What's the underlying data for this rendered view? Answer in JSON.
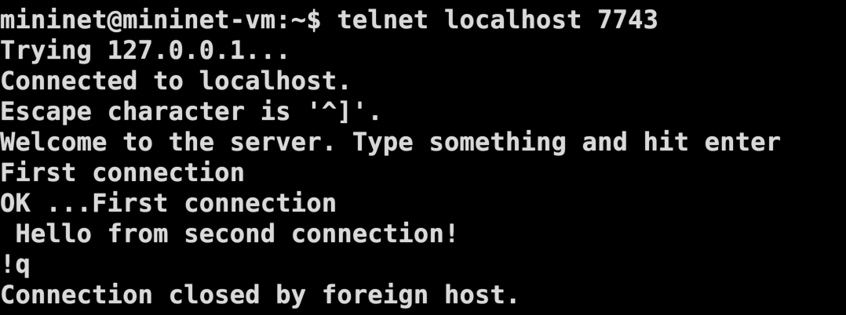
{
  "terminal": {
    "colors": {
      "background": "#000000",
      "foreground": "#d9d9d9"
    },
    "lines": [
      "mininet@mininet-vm:~$ telnet localhost 7743",
      "Trying 127.0.0.1...",
      "Connected to localhost.",
      "Escape character is '^]'.",
      "Welcome to the server. Type something and hit enter",
      "First connection",
      "OK ...First connection",
      " Hello from second connection!",
      "!q",
      "Connection closed by foreign host."
    ]
  }
}
